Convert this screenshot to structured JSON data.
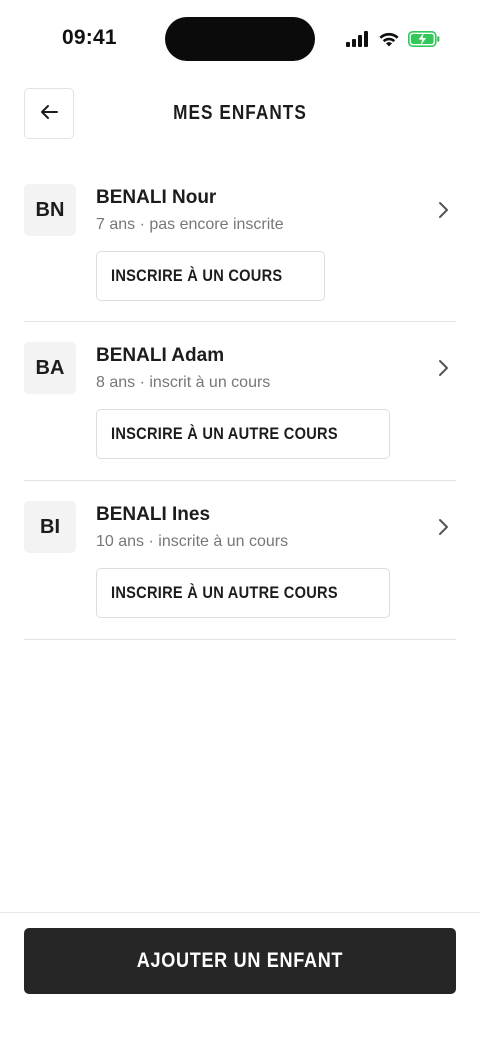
{
  "status_bar": {
    "time": "09:41",
    "icons": [
      "signal-icon",
      "wifi-icon",
      "battery-charging-icon"
    ],
    "battery_color": "#34c759"
  },
  "header": {
    "back_icon": "arrow-left-icon",
    "title": "MES ENFANTS"
  },
  "children": [
    {
      "initials": "BN",
      "name": "BENALI Nour",
      "subtitle": "7 ans · pas encore inscrite",
      "action_label": "INSCRIRE À UN COURS"
    },
    {
      "initials": "BA",
      "name": "BENALI Adam",
      "subtitle": "8 ans · inscrit à un cours",
      "action_label": "INSCRIRE À UN AUTRE COURS"
    },
    {
      "initials": "BI",
      "name": "BENALI Ines",
      "subtitle": "10 ans · inscrite à un cours",
      "action_label": "INSCRIRE À UN AUTRE COURS"
    }
  ],
  "footer": {
    "add_child_label": "AJOUTER UN ENFANT"
  },
  "colors": {
    "primary_button": "#262626",
    "avatar_background": "#f3f3f3",
    "secondary_text": "#777777"
  }
}
